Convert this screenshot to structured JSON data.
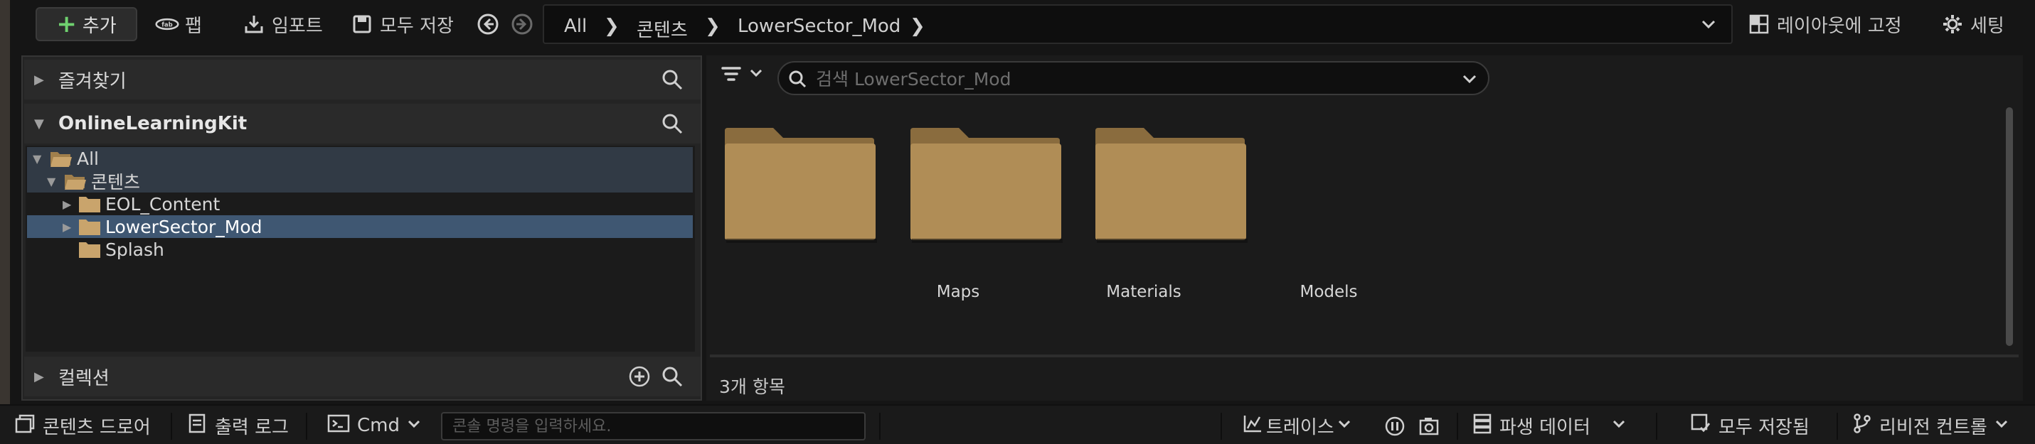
{
  "toolbar": {
    "add_label": "추가",
    "fab_label": "팹",
    "import_label": "임포트",
    "save_all_label": "모두 저장",
    "layout_lock_label": "레이아웃에 고정",
    "settings_label": "세팅"
  },
  "breadcrumb": {
    "items": [
      "All",
      "콘텐츠",
      "LowerSector_Mod"
    ]
  },
  "left_panel": {
    "favorites_label": "즐겨찾기",
    "project_label": "OnlineLearningKit",
    "collections_label": "컬렉션",
    "tree": [
      {
        "label": "All"
      },
      {
        "label": "콘텐츠"
      },
      {
        "label": "EOL_Content"
      },
      {
        "label": "LowerSector_Mod"
      },
      {
        "label": "Splash"
      }
    ]
  },
  "right_panel": {
    "search_placeholder": "검색 LowerSector_Mod",
    "folders": [
      {
        "label": "Maps"
      },
      {
        "label": "Materials"
      },
      {
        "label": "Models"
      }
    ],
    "item_count": "3개 항목"
  },
  "statusbar": {
    "content_drawer_label": "콘텐츠 드로어",
    "output_log_label": "출력 로그",
    "cmd_label": "Cmd",
    "cmd_placeholder": "콘솔 명령을 입력하세요.",
    "trace_label": "트레이스",
    "derived_data_label": "파생 데이터",
    "all_saved_label": "모두 저장됨",
    "revision_control_label": "리비전 컨트롤"
  },
  "colors": {
    "folder": "#b08d56",
    "selection": "#3f5772",
    "add_icon": "#6fd16f"
  }
}
